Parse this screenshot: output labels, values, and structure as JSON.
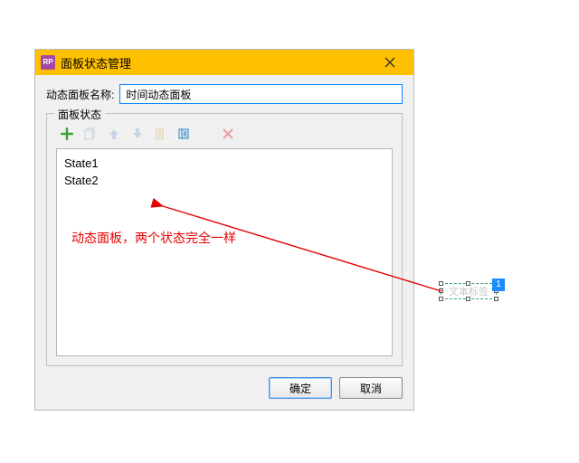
{
  "dialog": {
    "app_icon_text": "RP",
    "title": "面板状态管理",
    "name_label": "动态面板名称:",
    "name_value": "时间动态面板",
    "fieldset_legend": "面板状态",
    "states": [
      "State1",
      "State2"
    ],
    "annotation": "动态面板，两个状态完全一样",
    "ok_label": "确定",
    "cancel_label": "取消"
  },
  "external": {
    "widget_text": "文本标签",
    "badge": "1"
  }
}
